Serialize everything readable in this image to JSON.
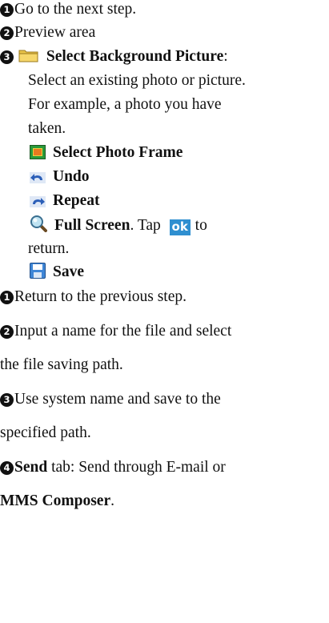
{
  "items_top": [
    {
      "num": "1",
      "text": "Go to the next step."
    },
    {
      "num": "2",
      "text": "Preview area"
    }
  ],
  "item3": {
    "num": "3",
    "title": "Select Background Picture",
    "colon": ":",
    "desc_lines": [
      "Select an existing photo or picture.",
      "For example, a photo you have",
      "taken."
    ]
  },
  "tools": {
    "photo_frame": "Select Photo Frame",
    "undo": "Undo",
    "repeat": "Repeat",
    "full_screen": "Full Screen",
    "full_screen_suffix": ". Tap",
    "ok": "ok",
    "to": "to",
    "return": "return.",
    "save": "Save"
  },
  "items_bottom": [
    {
      "num": "1",
      "text": "Return to the previous step."
    },
    {
      "num": "2",
      "line1": "Input a name for the file and select",
      "line2": "the file saving path."
    },
    {
      "num": "3",
      "line1": "Use system name and save to the",
      "line2": "specified path."
    },
    {
      "num": "4",
      "bold": "Send",
      "line1_rest": " tab: Send through E-mail or",
      "line2_bold": "MMS Composer",
      "line2_end": "."
    }
  ],
  "icons": [
    "folder-icon",
    "photo-frame-icon",
    "undo-icon",
    "repeat-icon",
    "magnifier-icon",
    "ok-icon",
    "save-disk-icon"
  ]
}
